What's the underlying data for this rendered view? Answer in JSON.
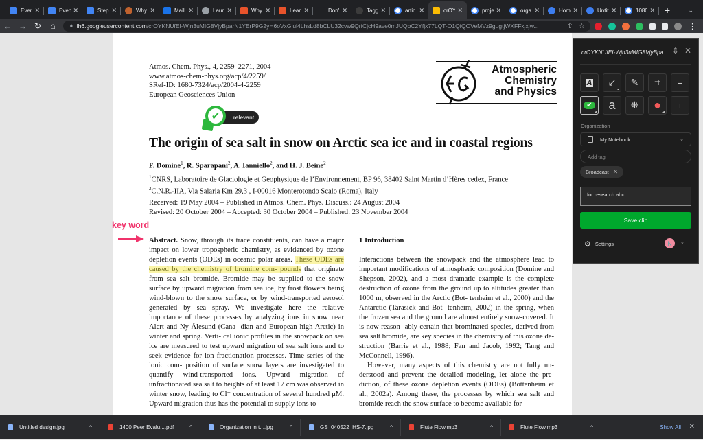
{
  "browser": {
    "tabs": [
      {
        "label": "Even",
        "icon": "google-docs-icon",
        "color": "#4285f4"
      },
      {
        "label": "Even",
        "icon": "google-docs-icon",
        "color": "#4285f4"
      },
      {
        "label": "Step",
        "icon": "google-docs-icon",
        "color": "#4285f4"
      },
      {
        "label": "Why",
        "icon": "ring-icon",
        "color": "#c0622e"
      },
      {
        "label": "Mail",
        "icon": "outlook-icon",
        "color": "#1a73e8"
      },
      {
        "label": "Laun",
        "icon": "globe-icon",
        "color": "#9aa0a6"
      },
      {
        "label": "Why",
        "icon": "bug-icon",
        "color": "#e8532b"
      },
      {
        "label": "Lean",
        "icon": "bug-icon",
        "color": "#e8532b"
      },
      {
        "label": "Don'",
        "icon": "bird-icon",
        "color": "#202124"
      },
      {
        "label": "Tagg",
        "icon": "circle-icon",
        "color": "#3c3c3c"
      },
      {
        "label": "artic",
        "icon": "google-icon",
        "color": "#ffffff"
      },
      {
        "label": "crOY",
        "icon": "google-photos-icon",
        "color": "#fbbc04",
        "active": true
      },
      {
        "label": "proje",
        "icon": "google-icon",
        "color": "#ffffff"
      },
      {
        "label": "orga",
        "icon": "google-icon",
        "color": "#ffffff"
      },
      {
        "label": "Hom",
        "icon": "canva-icon",
        "color": "#3d7ef0"
      },
      {
        "label": "Untit",
        "icon": "canva-icon",
        "color": "#3d7ef0"
      },
      {
        "label": "1080",
        "icon": "google-icon",
        "color": "#ffffff"
      }
    ],
    "new_tab": "+",
    "tab_search": "⌄",
    "url_host": "lh6.googleusercontent.com",
    "url_path": "/crOYKNUfEI-Wjn3uMIG8VjyBparN1YErP9G2yH6oVxGiul4LhsLd8bCLU32cvw9QrfCjcH9ave0mJUQbC2Yfjx77LQT-O1QfQOVeMVz9gugtjWXFFkjxjw...",
    "extensions": [
      {
        "name": "red-extension-icon",
        "color": "#e5202e"
      },
      {
        "name": "grammarly-icon",
        "color": "#15c39a"
      },
      {
        "name": "megaphone-extension-icon",
        "color": "#f2703d"
      },
      {
        "name": "evernote-icon",
        "color": "#2dbe60"
      },
      {
        "name": "puzzle-extensions-icon",
        "color": "#e8eaed"
      },
      {
        "name": "sidepanel-icon",
        "color": "#e8eaed"
      },
      {
        "name": "profile-avatar-icon",
        "color": "#8a8a8a"
      }
    ]
  },
  "paper": {
    "journal_lines": [
      "Atmos. Chem. Phys., 4, 2259–2271, 2004",
      "www.atmos-chem-phys.org/acp/4/2259/",
      "SRef-ID: 1680-7324/acp/2004-4-2259",
      "European Geosciences Union"
    ],
    "logo_lines": [
      "Atmospheric",
      "Chemistry",
      "and Physics"
    ],
    "title": "The origin of sea salt in snow on Arctic sea ice and in coastal regions",
    "authors": [
      {
        "name": "F. Domine",
        "aff": "1"
      },
      {
        "name": "R. Sparapani",
        "aff": "2"
      },
      {
        "name": "A. Ianniello",
        "aff": "2"
      },
      {
        "name": "and H. J. Beine",
        "aff": "2"
      }
    ],
    "affiliations": [
      {
        "num": "1",
        "text": "CNRS, Laboratoire de Glaciologie et Geophysique de l’Environnement, BP 96, 38402 Saint Martin d’Hères cedex, France"
      },
      {
        "num": "2",
        "text": "C.N.R.-IIA, Via Salaria Km 29,3 , I-00016 Monterotondo Scalo (Roma), Italy"
      }
    ],
    "dates": [
      "Received: 19 May 2004 – Published in Atmos. Chem. Phys. Discuss.: 24 August 2004",
      "Revised: 20 October 2004 – Accepted: 30 October 2004 – Published: 23 November 2004"
    ],
    "abstract": {
      "label": "Abstract.",
      "before": " Snow, through its trace constituents, can have a major impact on lower tropospheric chemistry, as evidenced by ozone depletion events (ODEs) in oceanic polar areas. ",
      "highlight": "These ODEs are caused by the chemistry of bromine com- pounds",
      "after": " that originate from sea salt bromide. Bromide may be supplied to the snow surface by upward migration from sea ice, by frost flowers being wind-blown to the snow surface, or by wind-transported aerosol generated by sea spray.  We investigate here the relative importance of these processes by analyzing ions in snow near Alert and Ny-Ålesund (Cana- dian and European high Arctic) in winter and spring. Verti- cal ionic profiles in the snowpack on sea ice are measured to test upward migration of sea salt ions and to seek evidence for ion fractionation processes. Time series of the ionic com- position of surface snow layers are investigated to quantify wind-transported ions.  Upward migration of unfractionated sea salt to heights of at least 17 cm was observed in winter snow, leading to Cl⁻ concentration of several hundred μM. Upward migration thus has the potential to supply ions to"
    },
    "intro": {
      "heading": "1   Introduction",
      "para1": "Interactions between the snowpack and the atmosphere lead to important modifications of atmospheric composition (Domine and Shepson, 2002), and a most dramatic example is the complete destruction of ozone from the ground up to altitudes greater than 1000 m, observed in the Arctic (Bot- tenheim et al., 2000) and the Antarctic (Tarasick and Bot- tenheim, 2002) in the spring, when the frozen sea and the ground are almost entirely snow-covered.  It is now reason- ably certain that brominated species, derived from sea salt bromide, are key species in the chemistry of this ozone de- struction (Barrie et al., 1988; Fan and Jacob, 1992; Tang and McConnell, 1996).",
      "para2": "However, many aspects of this chemistry are not fully un- derstood and prevent the detailed modeling, let alone the pre- diction, of these ozone depletion events (ODEs) (Bottenheim et al., 2002a). Among these, the processes by which sea salt and bromide reach the snow surface to become available for"
    },
    "annotations": {
      "stamp_label": "relevant",
      "keyword_label": "key word",
      "accent_color": "#f0336b"
    }
  },
  "clipper": {
    "title": "crOYKNUfEI-Wjn3uMIG8VjyBpa",
    "tools_row1": [
      {
        "name": "text-highlight-tool-icon",
        "glyph": "A"
      },
      {
        "name": "arrow-tool-icon",
        "glyph": "↙"
      },
      {
        "name": "pen-tool-icon",
        "glyph": "✎"
      },
      {
        "name": "crop-tool-icon",
        "glyph": "⌗"
      },
      {
        "name": "zoom-out-icon",
        "glyph": "−"
      }
    ],
    "tools_row2": [
      {
        "name": "stamp-tool-icon",
        "glyph": "✔"
      },
      {
        "name": "text-tool-icon",
        "glyph": "a"
      },
      {
        "name": "pixelate-tool-icon",
        "glyph": "⁜"
      },
      {
        "name": "color-picker-icon",
        "glyph": "●"
      },
      {
        "name": "zoom-in-icon",
        "glyph": "+"
      }
    ],
    "organization_label": "Organization",
    "notebook": "My Notebook",
    "tag_placeholder": "Add tag",
    "tags": [
      "Broadcast"
    ],
    "note": "for research abc",
    "save_label": "Save clip",
    "settings_label": "Settings",
    "avatar_initial": "N",
    "save_color": "#00a82d"
  },
  "downloads": {
    "items": [
      {
        "name": "Untitled design.jpg",
        "type": "image",
        "color": "#8ab4f8"
      },
      {
        "name": "1400 Peer Evalu....pdf",
        "type": "pdf",
        "color": "#ea4335"
      },
      {
        "name": "Organization in t....jpg",
        "type": "image",
        "color": "#8ab4f8"
      },
      {
        "name": "GS_040522_HS-7.jpg",
        "type": "image",
        "color": "#8ab4f8"
      },
      {
        "name": "Flute Flow.mp3",
        "type": "audio",
        "color": "#ea4335"
      },
      {
        "name": "Flute Flow.mp3",
        "type": "audio",
        "color": "#ea4335"
      }
    ],
    "show_all": "Show All",
    "close": "✕"
  }
}
